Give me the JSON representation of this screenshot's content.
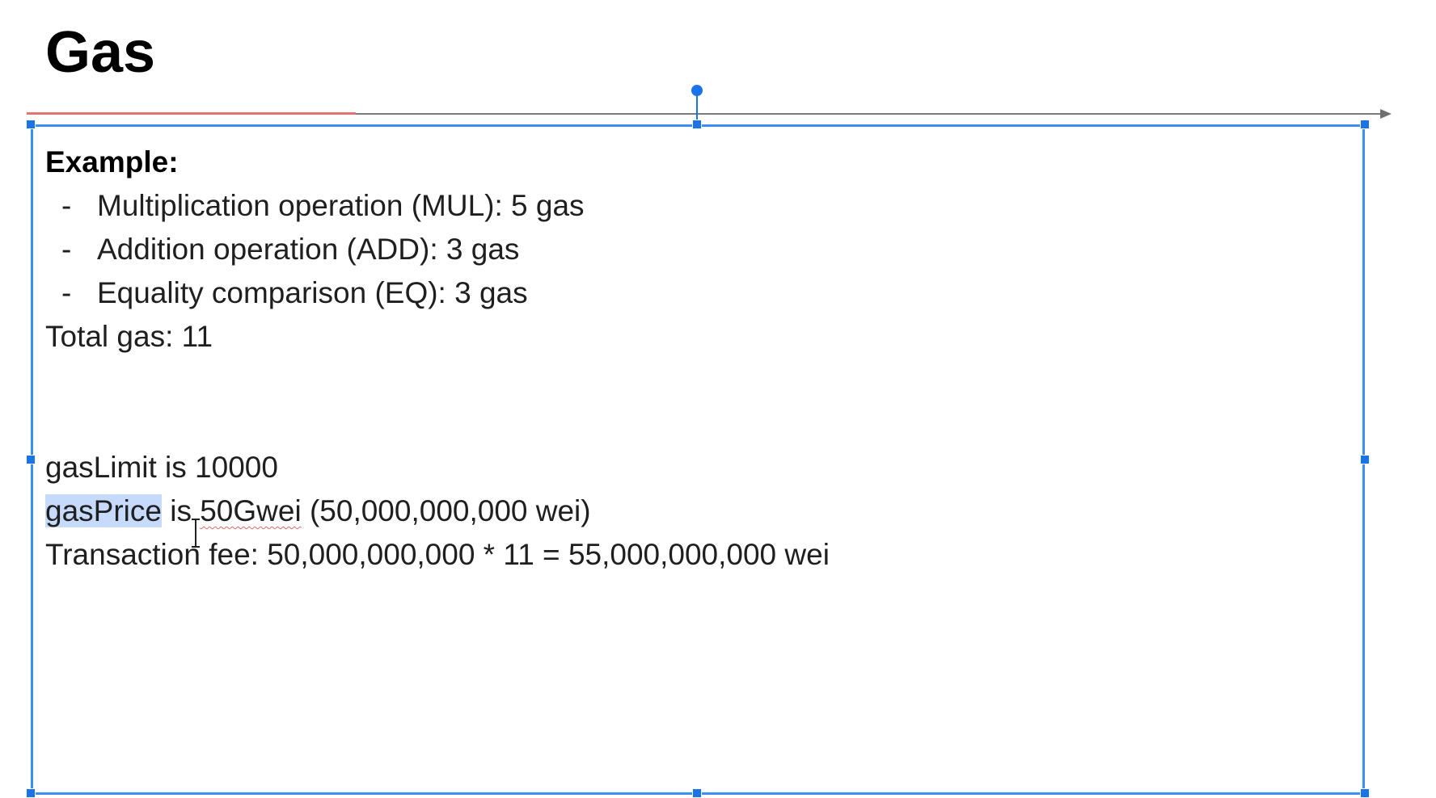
{
  "slide": {
    "title": "Gas"
  },
  "textbox": {
    "heading": "Example:",
    "bullets": [
      {
        "dash": "-",
        "text": "Multiplication operation (MUL): 5 gas"
      },
      {
        "dash": "-",
        "text": "Addition operation (ADD): 3 gas"
      },
      {
        "dash": "-",
        "text": "Equality comparison (EQ): 3 gas"
      }
    ],
    "total": "Total gas: 11",
    "gas_limit": "gasLimit is 10000",
    "gas_price": {
      "selected_word": "gasPrice",
      "middle": " is ",
      "underlined_word": "50Gwei",
      "rest": " (50,000,000,000 wei)"
    },
    "fee": "Transaction fee: 50,000,000,000 * 11 = 55,000,000,000 wei"
  },
  "colors": {
    "selection_border": "#3b8ef3",
    "handle": "#1a73e8",
    "text_selection": "#c6dafc",
    "divider_accent": "#e57373"
  },
  "icons": [
    "rotate-handle-icon",
    "resize-handle-icon",
    "text-cursor-icon",
    "arrow-head-icon"
  ]
}
